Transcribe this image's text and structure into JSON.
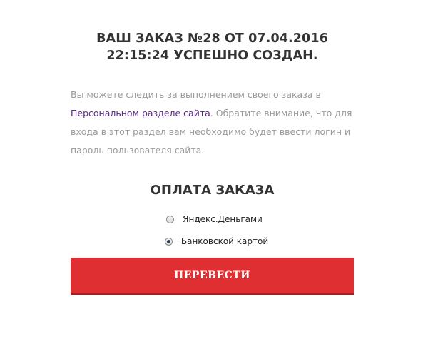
{
  "order": {
    "title_line1": "ВАШ ЗАКАЗ №28 ОТ 07.04.2016",
    "title_line2": "22:15:24 УСПЕШНО СОЗДАН."
  },
  "info": {
    "text_before_link": "Вы можете следить за выполнением своего заказа в ",
    "link_text": "Персональном разделе сайта",
    "text_after_link": ". Обратите внимание, что для входа в этот раздел вам необходимо будет ввести логин и пароль пользователя сайта."
  },
  "payment": {
    "title": "ОПЛАТА ЗАКАЗА",
    "options": [
      {
        "label": "Яндекс.Деньгами",
        "checked": false
      },
      {
        "label": "Банковской картой",
        "checked": true
      }
    ],
    "submit_label": "ПЕРЕВЕСТИ"
  },
  "colors": {
    "button": "#e02f32",
    "link": "#5a2a82",
    "muted_text": "#9a9a9a",
    "heading": "#333333"
  }
}
